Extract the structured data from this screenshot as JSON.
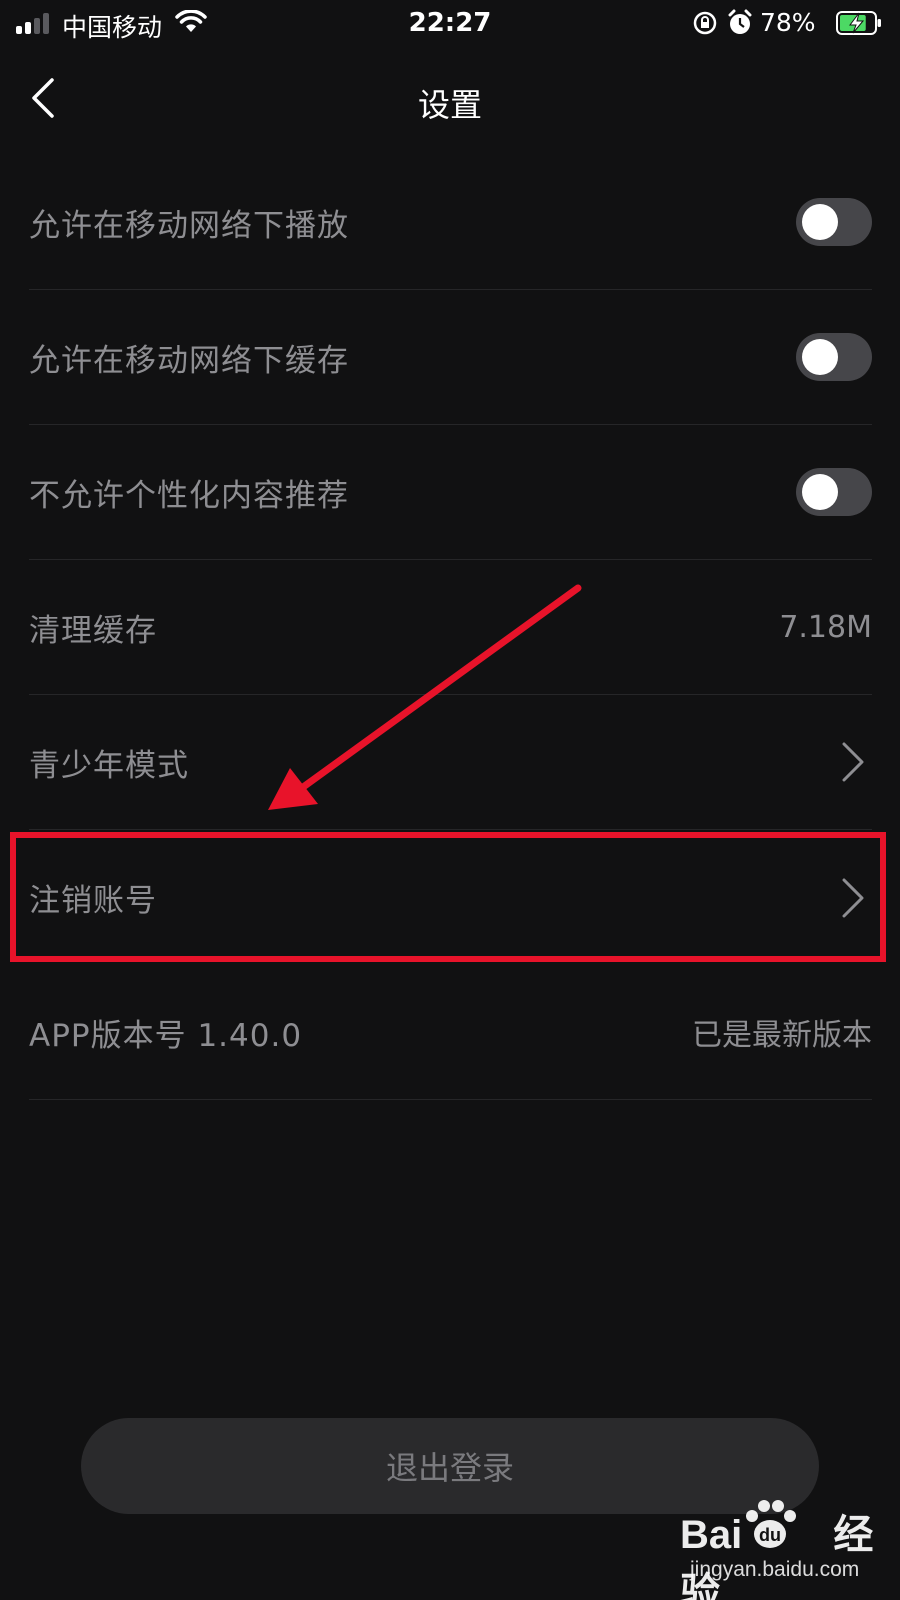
{
  "status_bar": {
    "carrier": "中国移动",
    "time": "22:27",
    "battery": "78%",
    "icons": [
      "signal-icon",
      "wifi-icon",
      "orientation-lock-icon",
      "alarm-icon",
      "battery-charging-icon"
    ],
    "battery_level": 0.78,
    "battery_color": "#4cd964"
  },
  "nav": {
    "title": "设置",
    "back_icon": "chevron-left-icon"
  },
  "settings": {
    "mobile_play": {
      "label": "允许在移动网络下播放",
      "enabled": false
    },
    "mobile_cache": {
      "label": "允许在移动网络下缓存",
      "enabled": false
    },
    "no_personalized": {
      "label": "不允许个性化内容推荐",
      "enabled": false
    },
    "clear_cache": {
      "label": "清理缓存",
      "value": "7.18M"
    },
    "teen_mode": {
      "label": "青少年模式",
      "icon": "chevron-right-icon"
    },
    "delete_account": {
      "label": "注销账号",
      "icon": "chevron-right-icon"
    },
    "app_version": {
      "label": "APP版本号 1.40.0",
      "value": "已是最新版本"
    }
  },
  "logout": {
    "label": "退出登录"
  },
  "annotation": {
    "color": "#e8132a",
    "highlight": "delete_account"
  },
  "watermark": {
    "brand": "Bai du 经验",
    "url": "jingyan.baidu.com"
  },
  "colors": {
    "background": "#111112",
    "text_secondary": "#8e8e92",
    "divider": "#262628",
    "toggle_off": "#46464a"
  }
}
